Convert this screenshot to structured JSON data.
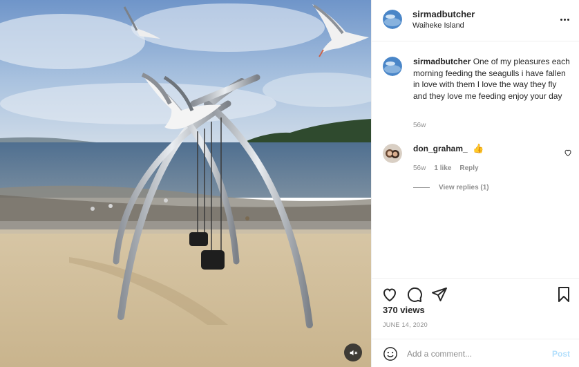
{
  "post": {
    "media": {
      "alt_icon": "mute-icon"
    },
    "author": {
      "username": "sirmadbutcher",
      "location": "Waiheke Island"
    },
    "caption": {
      "username": "sirmadbutcher",
      "text": "One of my pleasures each morning feeding the seagulls i have fallen in love with them I love the way they fly and they love me feeding enjoy your day",
      "time": "56w"
    },
    "comments": [
      {
        "username": "don_graham_",
        "text": "👍",
        "time": "56w",
        "likes": "1 like",
        "reply_label": "Reply",
        "view_replies": "View replies (1)"
      }
    ],
    "views": "370 views",
    "date": "JUNE 14, 2020",
    "composer": {
      "placeholder": "Add a comment...",
      "post_label": "Post"
    }
  },
  "colors": {
    "accent_disabled": "#b2dffc",
    "muted_text": "#8e8e8e",
    "text": "#262626",
    "divider": "#efefef"
  }
}
